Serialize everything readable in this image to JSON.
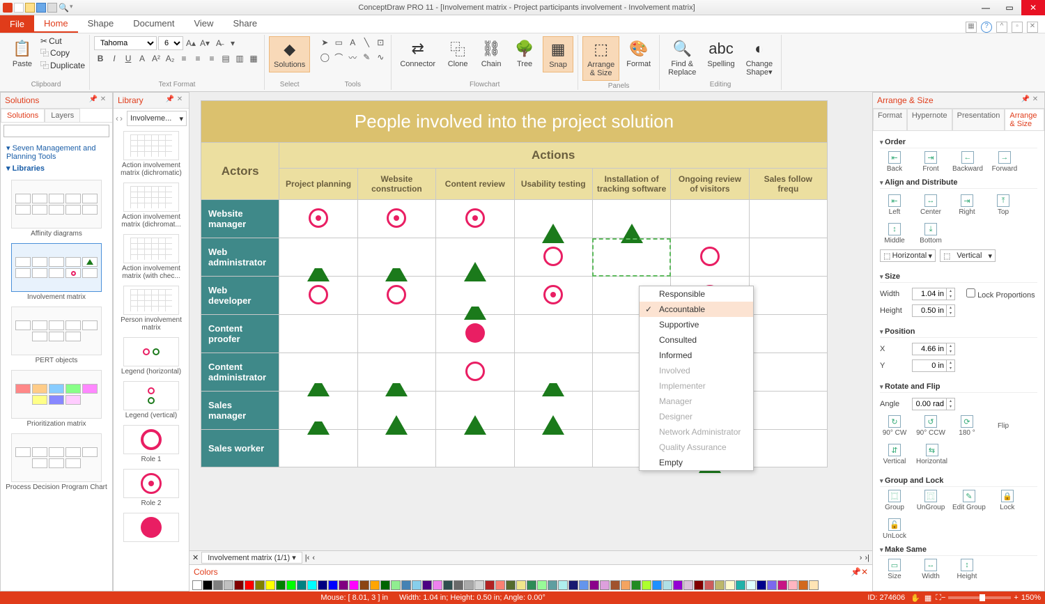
{
  "app": {
    "title": "ConceptDraw PRO 11 - [Involvement matrix - Project participants involvement - Involvement matrix]"
  },
  "tabs": {
    "file": "File",
    "home": "Home",
    "shape": "Shape",
    "document": "Document",
    "view": "View",
    "share": "Share"
  },
  "clipboard": {
    "paste": "Paste",
    "cut": "Cut",
    "copy": "Copy",
    "duplicate": "Duplicate",
    "group": "Clipboard"
  },
  "textformat": {
    "font": "Tahoma",
    "size": "6",
    "group": "Text Format"
  },
  "ribbon": {
    "select": "Select",
    "tools": "Tools",
    "solutions": "Solutions",
    "connector": "Connector",
    "clone": "Clone",
    "chain": "Chain",
    "tree": "Tree",
    "snap": "Snap",
    "flowchart": "Flowchart",
    "arrange": "Arrange\n& Size",
    "format": "Format",
    "panels": "Panels",
    "findreplace": "Find &\nReplace",
    "spelling": "Spelling",
    "changeshape": "Change\nShape▾",
    "editing": "Editing"
  },
  "solutions_panel": {
    "title": "Solutions",
    "tab1": "Solutions",
    "tab2": "Layers",
    "tree1": "Seven Management and Planning Tools",
    "tree2": "Libraries",
    "g1": "Affinity diagrams",
    "g2": "Involvement matrix",
    "g3": "PERT objects",
    "g4": "Prioritization matrix",
    "g5": "Process Decision Program Chart"
  },
  "library_panel": {
    "title": "Library",
    "drop": "Involveme...",
    "i1": "Action involvement matrix (dichromatic)",
    "i2": "Action involvement matrix (dichromat...",
    "i3": "Action involvement matrix (with chec...",
    "i4": "Person involvement matrix",
    "i5": "Legend (horizontal)",
    "i6": "Legend (vertical)",
    "i7": "Role 1",
    "i8": "Role 2"
  },
  "matrix": {
    "title": "People involved into the project solution",
    "actors_label": "Actors",
    "actions_label": "Actions",
    "cols": [
      "Project planning",
      "Website construction",
      "Content review",
      "Usability testing",
      "Installation of tracking software",
      "Ongoing review of visitors",
      "Sales follow frequ"
    ],
    "rows": [
      "Website manager",
      "Web administrator",
      "Web developer",
      "Content proofer",
      "Content administrator",
      "Sales manager",
      "Sales worker"
    ],
    "cells": [
      [
        "cd",
        "cd",
        "cd",
        "ts",
        "ts",
        "",
        ""
      ],
      [
        "th",
        "th",
        "ts",
        "ch",
        "sel",
        "ch",
        ""
      ],
      [
        "ch",
        "ch",
        "th",
        "cd",
        "",
        "cd",
        ""
      ],
      [
        "",
        "",
        "cs",
        "",
        "",
        "",
        ""
      ],
      [
        "th",
        "th",
        "ch",
        "th",
        "",
        "",
        ""
      ],
      [
        "th",
        "ts",
        "ts",
        "ts",
        "",
        "ts",
        ""
      ],
      [
        "",
        "",
        "",
        "",
        "",
        "ts",
        ""
      ]
    ]
  },
  "context_menu": {
    "items": [
      "Responsible",
      "Accountable",
      "Supportive",
      "Consulted",
      "Informed",
      "Involved",
      "Implementer",
      "Manager",
      "Designer",
      "Network Administrator",
      "Quality Assurance",
      "Empty"
    ],
    "selected_index": 1,
    "disabled_from": 5,
    "disabled_to": 10
  },
  "sheet": {
    "tab": "Involvement matrix (1/1)"
  },
  "colors_panel": {
    "title": "Colors"
  },
  "arrange_panel": {
    "title": "Arrange & Size",
    "tabs": [
      "Format",
      "Hypernote",
      "Presentation",
      "Arrange & Size"
    ],
    "order": {
      "head": "Order",
      "back": "Back",
      "front": "Front",
      "backward": "Backward",
      "forward": "Forward"
    },
    "align": {
      "head": "Align and Distribute",
      "left": "Left",
      "center": "Center",
      "right": "Right",
      "top": "Top",
      "middle": "Middle",
      "bottom": "Bottom",
      "horiz": "Horizontal",
      "vert": "Vertical"
    },
    "size": {
      "head": "Size",
      "width_l": "Width",
      "height_l": "Height",
      "width": "1.04 in",
      "height": "0.50 in",
      "lock": "Lock Proportions"
    },
    "position": {
      "head": "Position",
      "x_l": "X",
      "y_l": "Y",
      "x": "4.66 in",
      "y": "0 in"
    },
    "rotate": {
      "head": "Rotate and Flip",
      "angle_l": "Angle",
      "angle": "0.00 rad",
      "cw": "90° CW",
      "ccw": "90° CCW",
      "r180": "180 °",
      "flip": "Flip",
      "flipv": "Vertical",
      "fliph": "Horizontal"
    },
    "grouplock": {
      "head": "Group and Lock",
      "group": "Group",
      "ungroup": "UnGroup",
      "editgroup": "Edit Group",
      "lock": "Lock",
      "unlock": "UnLock"
    },
    "makesame": {
      "head": "Make Same",
      "size": "Size",
      "width": "Width",
      "height": "Height"
    }
  },
  "status": {
    "mouse": "Mouse: [ 8.01, 3 ] in",
    "dims": "Width: 1.04 in;  Height: 0.50 in;  Angle: 0.00°",
    "id": "ID: 274606",
    "zoom": "150%"
  }
}
